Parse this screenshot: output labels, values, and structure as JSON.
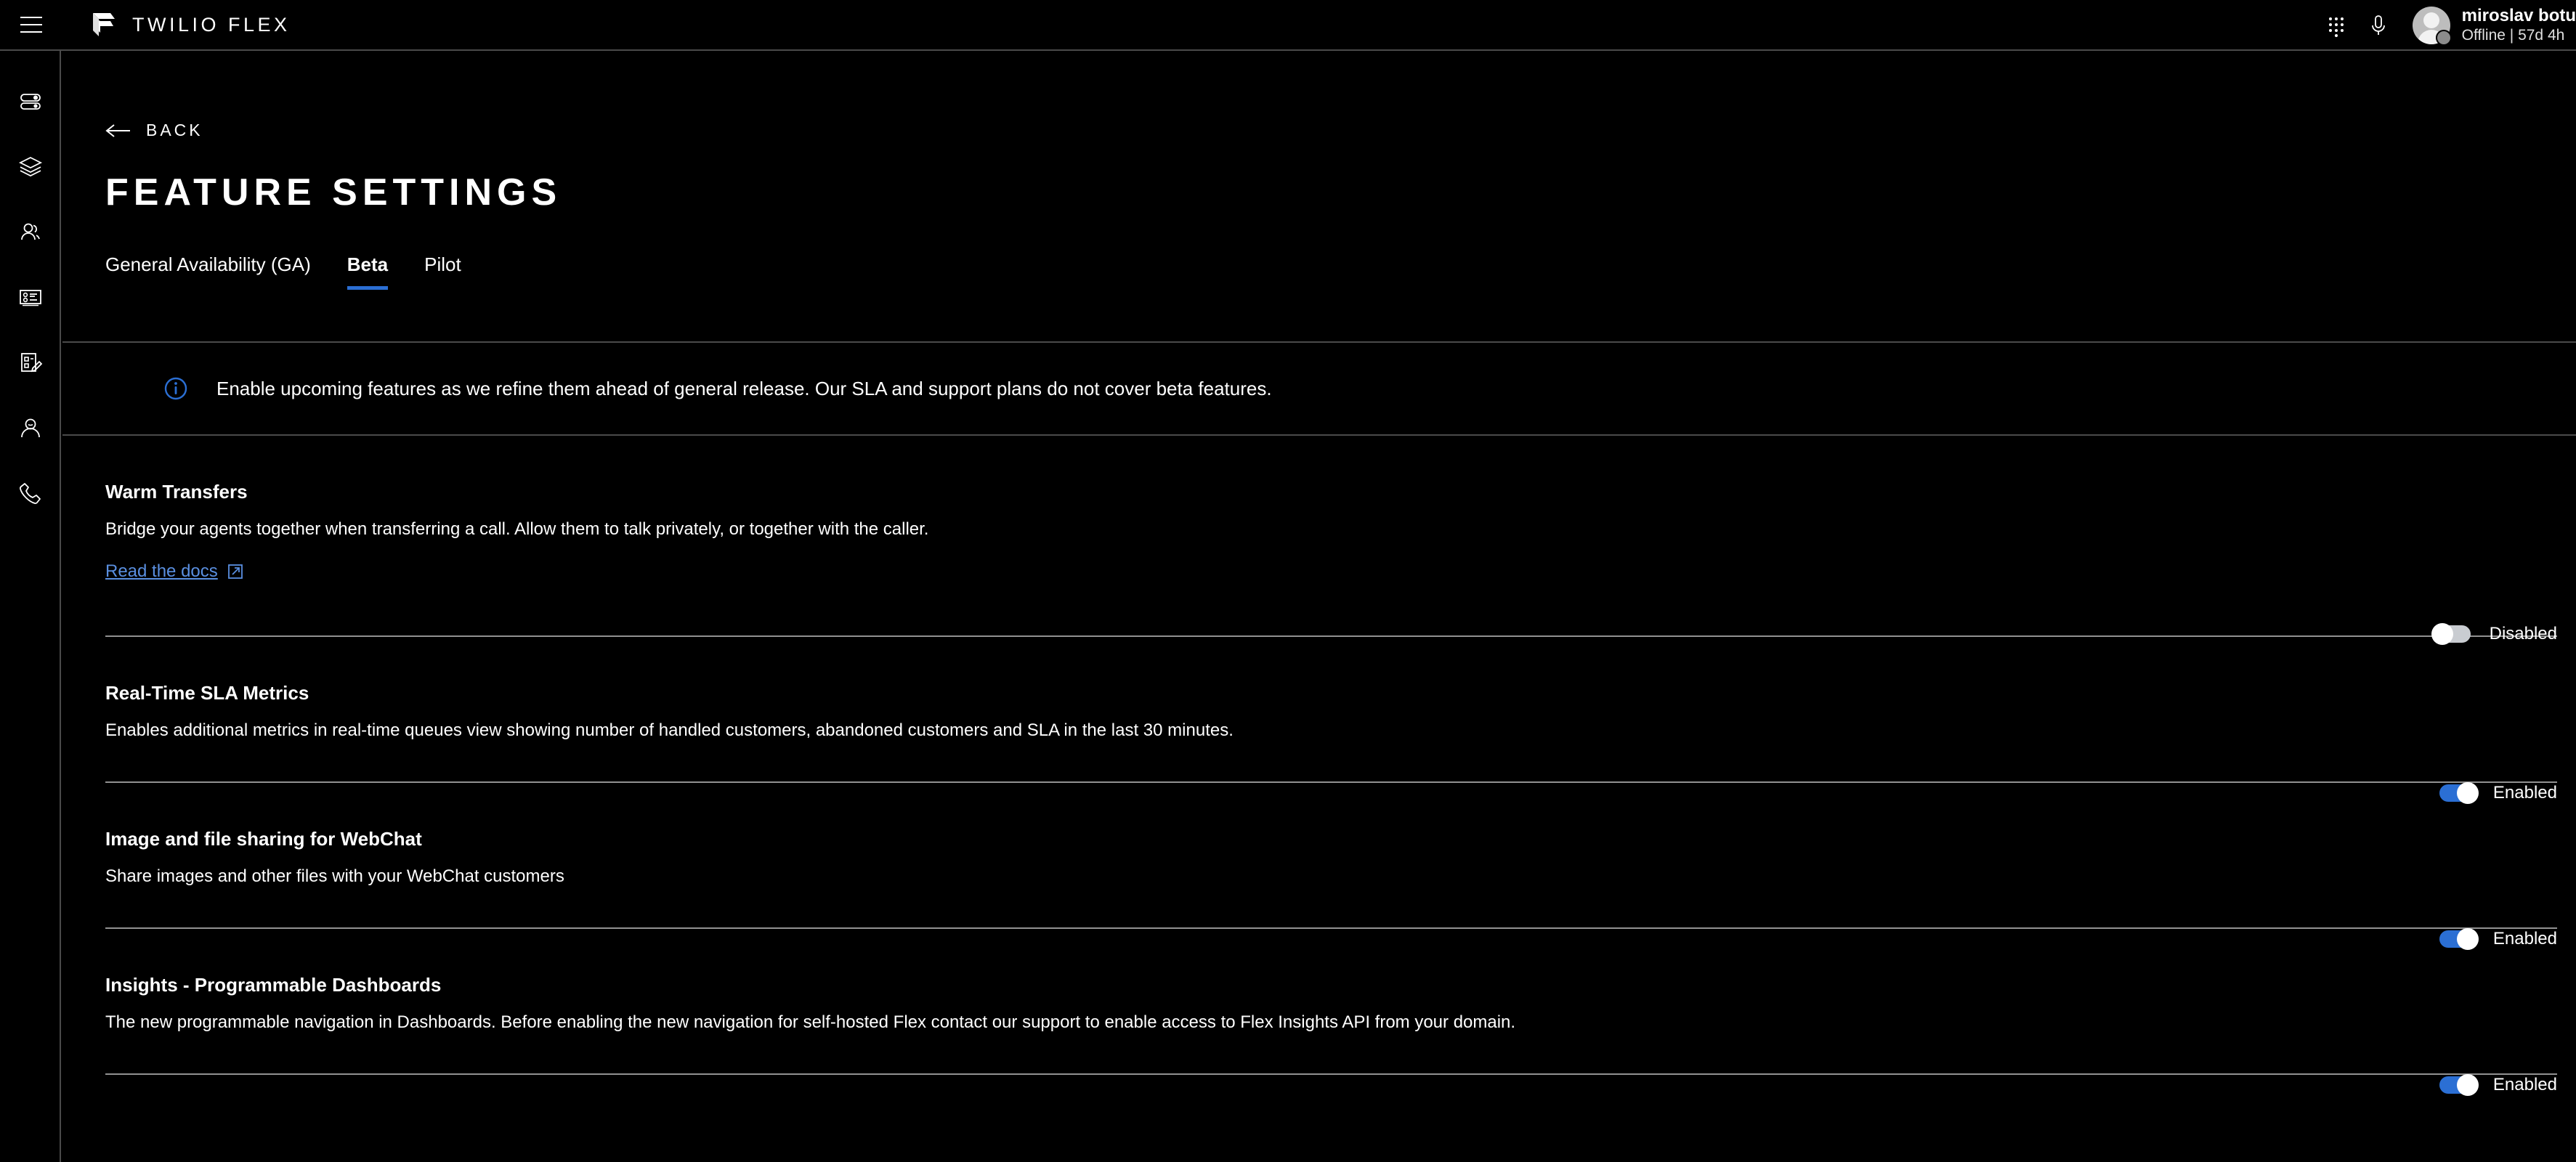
{
  "topbar": {
    "menu_icon": "hamburger-menu-icon",
    "brand_name": "TWILIO FLEX",
    "logo_icon": "twilio-flex-logo",
    "dialpad_icon": "dialpad-grid-icon",
    "mic_icon": "microphone-icon",
    "user": {
      "name": "miroslav botu",
      "status": "Offline | 57d 4h",
      "avatar_icon": "user-avatar",
      "presence_icon": "offline-presence-dot"
    }
  },
  "sidebar": {
    "items": [
      {
        "name": "sidebar-item-settings",
        "icon": "sliders-toggle-icon"
      },
      {
        "name": "sidebar-item-queues",
        "icon": "layers-stack-icon"
      },
      {
        "name": "sidebar-item-teams",
        "icon": "people-group-icon"
      },
      {
        "name": "sidebar-item-dashboard",
        "icon": "list-card-icon"
      },
      {
        "name": "sidebar-item-tasks",
        "icon": "edit-form-icon"
      },
      {
        "name": "sidebar-item-agent",
        "icon": "person-icon"
      },
      {
        "name": "sidebar-item-calls",
        "icon": "phone-icon"
      }
    ]
  },
  "page": {
    "back_label": "BACK",
    "back_icon": "arrow-left-icon",
    "title": "FEATURE SETTINGS"
  },
  "tabs": [
    {
      "label": "General Availability (GA)",
      "active": false
    },
    {
      "label": "Beta",
      "active": true
    },
    {
      "label": "Pilot",
      "active": false
    }
  ],
  "banner": {
    "icon": "info-circle-icon",
    "text": "Enable upcoming features as we refine them ahead of general release. Our SLA and support plans do not cover beta features."
  },
  "features": [
    {
      "title": "Warm Transfers",
      "description": "Bridge your agents together when transferring a call. Allow them to talk privately, or together with the caller.",
      "link_label": "Read the docs",
      "link_icon": "external-link-icon",
      "toggle_state": "off",
      "toggle_label": "Disabled"
    },
    {
      "title": "Real-Time SLA Metrics",
      "description": "Enables additional metrics in real-time queues view showing number of handled customers, abandoned customers and SLA in the last 30 minutes.",
      "toggle_state": "on",
      "toggle_label": "Enabled"
    },
    {
      "title": "Image and file sharing for WebChat",
      "description": "Share images and other files with your WebChat customers",
      "toggle_state": "on",
      "toggle_label": "Enabled"
    },
    {
      "title": "Insights - Programmable Dashboards",
      "description": "The new programmable navigation in Dashboards. Before enabling the new navigation for self-hosted Flex contact our support to enable access to Flex Insights API from your domain.",
      "toggle_state": "on",
      "toggle_label": "Enabled"
    }
  ],
  "colors": {
    "background": "#000000",
    "accent_blue": "#2b6fd4",
    "link_blue": "#5a8fe0",
    "divider": "#4a4a4a",
    "row_divider": "#919191",
    "toggle_off_track": "#c9ccd1"
  }
}
